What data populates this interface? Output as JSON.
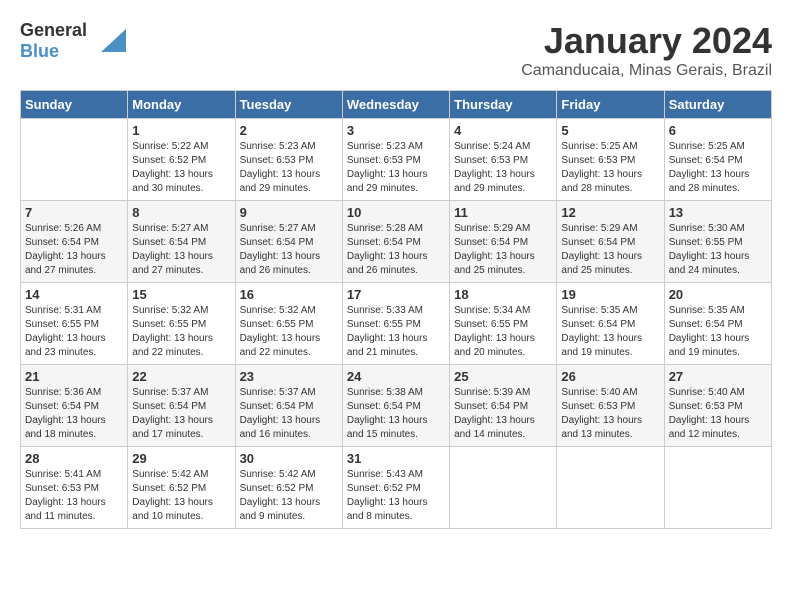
{
  "header": {
    "logo_general": "General",
    "logo_blue": "Blue",
    "title": "January 2024",
    "subtitle": "Camanducaia, Minas Gerais, Brazil"
  },
  "columns": [
    "Sunday",
    "Monday",
    "Tuesday",
    "Wednesday",
    "Thursday",
    "Friday",
    "Saturday"
  ],
  "weeks": [
    [
      {
        "day": "",
        "info": ""
      },
      {
        "day": "1",
        "info": "Sunrise: 5:22 AM\nSunset: 6:52 PM\nDaylight: 13 hours\nand 30 minutes."
      },
      {
        "day": "2",
        "info": "Sunrise: 5:23 AM\nSunset: 6:53 PM\nDaylight: 13 hours\nand 29 minutes."
      },
      {
        "day": "3",
        "info": "Sunrise: 5:23 AM\nSunset: 6:53 PM\nDaylight: 13 hours\nand 29 minutes."
      },
      {
        "day": "4",
        "info": "Sunrise: 5:24 AM\nSunset: 6:53 PM\nDaylight: 13 hours\nand 29 minutes."
      },
      {
        "day": "5",
        "info": "Sunrise: 5:25 AM\nSunset: 6:53 PM\nDaylight: 13 hours\nand 28 minutes."
      },
      {
        "day": "6",
        "info": "Sunrise: 5:25 AM\nSunset: 6:54 PM\nDaylight: 13 hours\nand 28 minutes."
      }
    ],
    [
      {
        "day": "7",
        "info": "Sunrise: 5:26 AM\nSunset: 6:54 PM\nDaylight: 13 hours\nand 27 minutes."
      },
      {
        "day": "8",
        "info": "Sunrise: 5:27 AM\nSunset: 6:54 PM\nDaylight: 13 hours\nand 27 minutes."
      },
      {
        "day": "9",
        "info": "Sunrise: 5:27 AM\nSunset: 6:54 PM\nDaylight: 13 hours\nand 26 minutes."
      },
      {
        "day": "10",
        "info": "Sunrise: 5:28 AM\nSunset: 6:54 PM\nDaylight: 13 hours\nand 26 minutes."
      },
      {
        "day": "11",
        "info": "Sunrise: 5:29 AM\nSunset: 6:54 PM\nDaylight: 13 hours\nand 25 minutes."
      },
      {
        "day": "12",
        "info": "Sunrise: 5:29 AM\nSunset: 6:54 PM\nDaylight: 13 hours\nand 25 minutes."
      },
      {
        "day": "13",
        "info": "Sunrise: 5:30 AM\nSunset: 6:55 PM\nDaylight: 13 hours\nand 24 minutes."
      }
    ],
    [
      {
        "day": "14",
        "info": "Sunrise: 5:31 AM\nSunset: 6:55 PM\nDaylight: 13 hours\nand 23 minutes."
      },
      {
        "day": "15",
        "info": "Sunrise: 5:32 AM\nSunset: 6:55 PM\nDaylight: 13 hours\nand 22 minutes."
      },
      {
        "day": "16",
        "info": "Sunrise: 5:32 AM\nSunset: 6:55 PM\nDaylight: 13 hours\nand 22 minutes."
      },
      {
        "day": "17",
        "info": "Sunrise: 5:33 AM\nSunset: 6:55 PM\nDaylight: 13 hours\nand 21 minutes."
      },
      {
        "day": "18",
        "info": "Sunrise: 5:34 AM\nSunset: 6:55 PM\nDaylight: 13 hours\nand 20 minutes."
      },
      {
        "day": "19",
        "info": "Sunrise: 5:35 AM\nSunset: 6:54 PM\nDaylight: 13 hours\nand 19 minutes."
      },
      {
        "day": "20",
        "info": "Sunrise: 5:35 AM\nSunset: 6:54 PM\nDaylight: 13 hours\nand 19 minutes."
      }
    ],
    [
      {
        "day": "21",
        "info": "Sunrise: 5:36 AM\nSunset: 6:54 PM\nDaylight: 13 hours\nand 18 minutes."
      },
      {
        "day": "22",
        "info": "Sunrise: 5:37 AM\nSunset: 6:54 PM\nDaylight: 13 hours\nand 17 minutes."
      },
      {
        "day": "23",
        "info": "Sunrise: 5:37 AM\nSunset: 6:54 PM\nDaylight: 13 hours\nand 16 minutes."
      },
      {
        "day": "24",
        "info": "Sunrise: 5:38 AM\nSunset: 6:54 PM\nDaylight: 13 hours\nand 15 minutes."
      },
      {
        "day": "25",
        "info": "Sunrise: 5:39 AM\nSunset: 6:54 PM\nDaylight: 13 hours\nand 14 minutes."
      },
      {
        "day": "26",
        "info": "Sunrise: 5:40 AM\nSunset: 6:53 PM\nDaylight: 13 hours\nand 13 minutes."
      },
      {
        "day": "27",
        "info": "Sunrise: 5:40 AM\nSunset: 6:53 PM\nDaylight: 13 hours\nand 12 minutes."
      }
    ],
    [
      {
        "day": "28",
        "info": "Sunrise: 5:41 AM\nSunset: 6:53 PM\nDaylight: 13 hours\nand 11 minutes."
      },
      {
        "day": "29",
        "info": "Sunrise: 5:42 AM\nSunset: 6:52 PM\nDaylight: 13 hours\nand 10 minutes."
      },
      {
        "day": "30",
        "info": "Sunrise: 5:42 AM\nSunset: 6:52 PM\nDaylight: 13 hours\nand 9 minutes."
      },
      {
        "day": "31",
        "info": "Sunrise: 5:43 AM\nSunset: 6:52 PM\nDaylight: 13 hours\nand 8 minutes."
      },
      {
        "day": "",
        "info": ""
      },
      {
        "day": "",
        "info": ""
      },
      {
        "day": "",
        "info": ""
      }
    ]
  ]
}
